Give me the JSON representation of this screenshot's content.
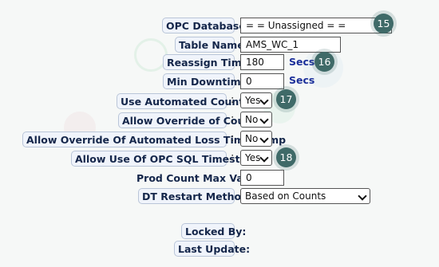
{
  "fields": {
    "opc_database": {
      "label": "OPC Database:",
      "value": "= = Unassigned = ="
    },
    "table_name": {
      "label": "Table Name:",
      "value": "AMS_WC_1"
    },
    "reassign_time": {
      "label": "Reassign Time:",
      "value": "180",
      "unit": "Secs"
    },
    "min_downtime": {
      "label": "Min Downtime:",
      "value": "0",
      "unit": "Secs"
    },
    "use_automated_counter": {
      "label": "Use Automated Counter",
      "value": "Yes"
    },
    "allow_override_count": {
      "label": "Allow Override of Count",
      "value": "No"
    },
    "allow_override_loss": {
      "label": "Allow Override Of Automated Loss Timestamp",
      "value": "No"
    },
    "allow_opc_sql_timestamp": {
      "label": "Allow Use Of OPC SQL Timestamp",
      "value": "Yes"
    },
    "prod_count_max": {
      "label": "Prod Count Max Value",
      "value": "0"
    },
    "dt_restart_method": {
      "label": "DT Restart Method:",
      "value": "Based on Counts"
    },
    "locked_by": {
      "label": "Locked By:"
    },
    "last_update": {
      "label": "Last Update:"
    }
  },
  "colon": ":",
  "badges": {
    "b15": "15",
    "b16": "16",
    "b17": "17",
    "b18": "18"
  },
  "colors": {
    "accent": "#3f6a68",
    "label_text": "#14264a",
    "unit_text": "#1b2f9a"
  }
}
